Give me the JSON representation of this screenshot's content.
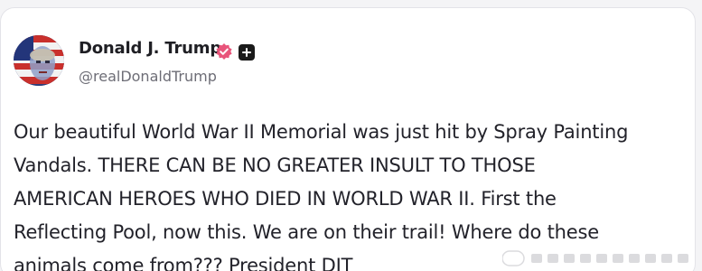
{
  "post": {
    "author": {
      "display_name": "Donald J. Trump",
      "handle": "@realDonaldTrump",
      "verified_badge": "verified-badge-icon",
      "extra_badge": "plus-icon"
    },
    "body": "Our beautiful World War II Memorial was just hit by Spray Painting\nVandals. THERE CAN BE NO GREATER INSULT TO THOSE\nAMERICAN HEROES WHO DIED IN WORLD WAR II. First the\nReflecting Pool, now this. We are on their trail! Where do these\nanimals come from??? President DJT"
  },
  "colors": {
    "verified": "#e8547a",
    "text": "#22222a",
    "handle": "#6d6d76"
  }
}
